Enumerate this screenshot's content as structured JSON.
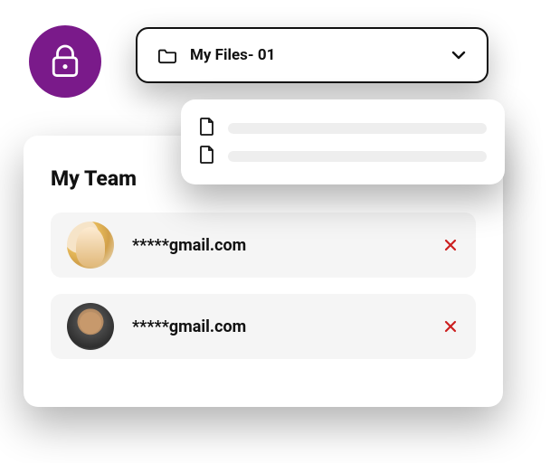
{
  "badge": {
    "color": "#7a1a8a"
  },
  "dropdown": {
    "label": "My Files- 01"
  },
  "team": {
    "title": "My Team",
    "members": [
      {
        "email": "*****gmail.com"
      },
      {
        "email": "*****gmail.com"
      }
    ]
  }
}
